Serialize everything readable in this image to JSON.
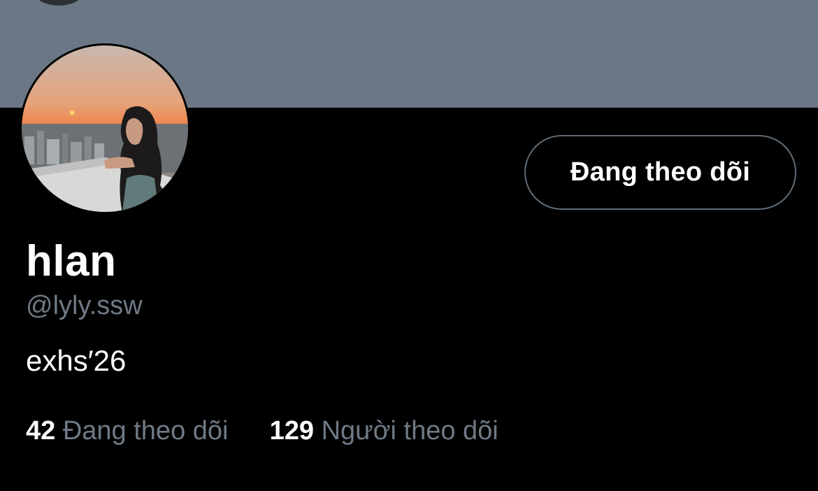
{
  "profile": {
    "display_name": "hlan",
    "handle": "@lyly.ssw",
    "bio": "exhs′26"
  },
  "actions": {
    "follow_label": "Đang theo dõi"
  },
  "stats": {
    "following_count": "42",
    "following_label": "Đang theo dõi",
    "followers_count": "129",
    "followers_label": "Người theo dõi"
  },
  "colors": {
    "banner": "#6b7784",
    "background": "#000000",
    "secondary_text": "#6e7a86",
    "button_border": "#5f6b76"
  },
  "icons": {
    "back": "back-button"
  }
}
